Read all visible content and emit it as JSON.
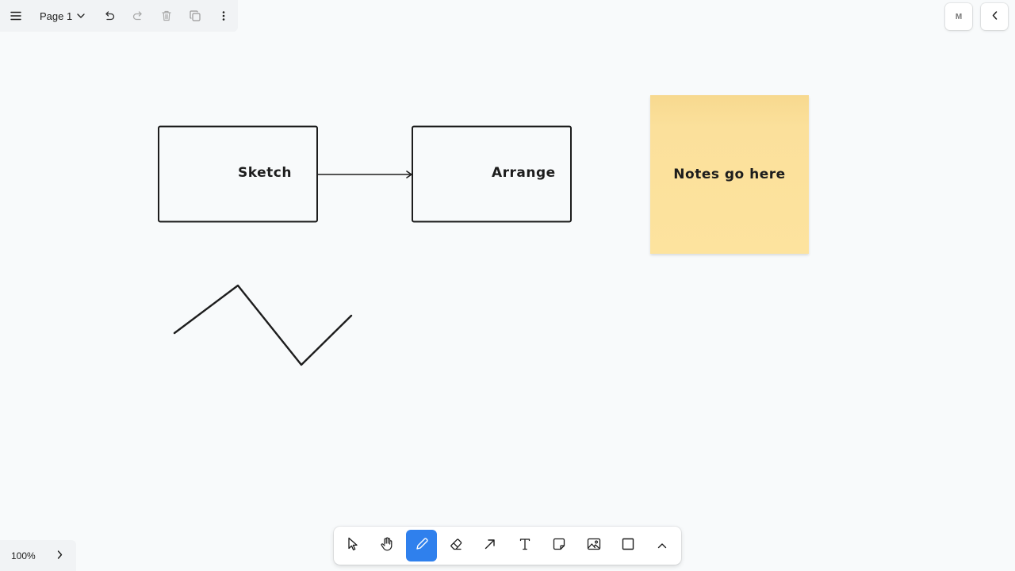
{
  "app": {
    "title": ""
  },
  "menu": {
    "page_label": "Page 1",
    "icons": [
      "hamburger-icon",
      "chevron-down-icon",
      "undo-icon",
      "redo-icon",
      "trash-icon",
      "duplicate-icon",
      "more-vertical-icon"
    ]
  },
  "top_right": {
    "avatar_initial": "M",
    "collapse_icon": "chevron-left-icon"
  },
  "canvas": {
    "shapes": [
      {
        "type": "rectangle",
        "label": "Sketch"
      },
      {
        "type": "rectangle",
        "label": "Arrange"
      },
      {
        "type": "arrow",
        "from": "Sketch",
        "to": "Arrange"
      },
      {
        "type": "sticky-note",
        "label": "Notes go here",
        "color": "#fde39e"
      },
      {
        "type": "freehand-line"
      }
    ]
  },
  "toolbar": {
    "tools": [
      {
        "name": "select",
        "icon": "pointer-icon",
        "selected": false
      },
      {
        "name": "hand",
        "icon": "hand-icon",
        "selected": false
      },
      {
        "name": "draw",
        "icon": "pencil-icon",
        "selected": true
      },
      {
        "name": "eraser",
        "icon": "eraser-icon",
        "selected": false
      },
      {
        "name": "arrow",
        "icon": "arrow-icon",
        "selected": false
      },
      {
        "name": "text",
        "icon": "text-icon",
        "selected": false
      },
      {
        "name": "note",
        "icon": "sticky-note-icon",
        "selected": false
      },
      {
        "name": "image",
        "icon": "image-icon",
        "selected": false
      },
      {
        "name": "rectangle",
        "icon": "rectangle-icon",
        "selected": false
      },
      {
        "name": "more",
        "icon": "chevron-up-icon",
        "selected": false
      }
    ],
    "accent_color": "#2f80ed"
  },
  "zoom": {
    "level": "100%"
  }
}
